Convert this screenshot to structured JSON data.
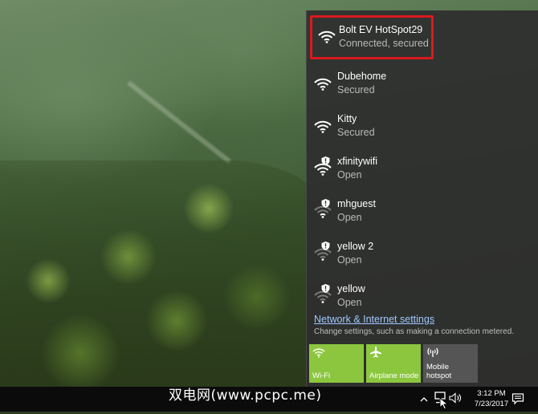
{
  "networks": [
    {
      "name": "Bolt EV HotSpot29",
      "status": "Connected, secured",
      "connected": true,
      "open": false
    },
    {
      "name": "Dubehome",
      "status": "Secured",
      "connected": false,
      "open": false
    },
    {
      "name": "Kitty",
      "status": "Secured",
      "connected": false,
      "open": false
    },
    {
      "name": "xfinitywifi",
      "status": "Open",
      "connected": false,
      "open": true
    },
    {
      "name": "mhguest",
      "status": "Open",
      "connected": false,
      "open": true
    },
    {
      "name": "yellow 2",
      "status": "Open",
      "connected": false,
      "open": true
    },
    {
      "name": "yellow",
      "status": "Open",
      "connected": false,
      "open": true
    }
  ],
  "settings": {
    "link": "Network & Internet settings",
    "description": "Change settings, such as making a connection metered."
  },
  "quick_actions": [
    {
      "label": "Wi-Fi",
      "icon": "wifi-icon",
      "state": "on"
    },
    {
      "label": "Airplane mode",
      "icon": "airplane-icon",
      "state": "on"
    },
    {
      "label": "Mobile\nhotspot",
      "icon": "hotspot-icon",
      "state": "off"
    }
  ],
  "taskbar": {
    "time": "3:12 PM",
    "date": "7/23/2017",
    "watermark": "双电网(www.pcpc.me)"
  },
  "colors": {
    "accent": "#8cc63f",
    "highlight": "#d9191f",
    "link": "#9fc7ff"
  }
}
